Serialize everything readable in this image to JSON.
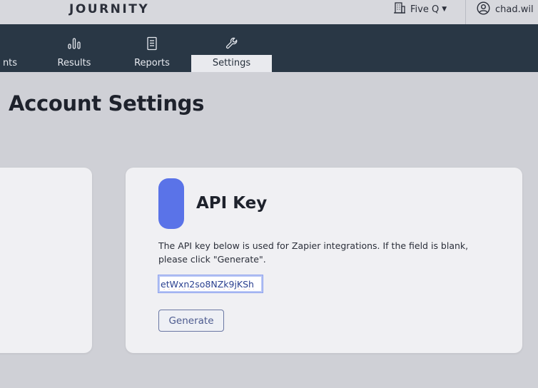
{
  "header": {
    "brand": "JOURNITY",
    "org_name": "Five Q",
    "user_name": "chad.wil"
  },
  "nav": {
    "tabs": [
      {
        "label": "nts",
        "icon": "partial-tab"
      },
      {
        "label": "Results",
        "icon": "bar-chart-icon"
      },
      {
        "label": "Reports",
        "icon": "document-icon"
      },
      {
        "label": "Settings",
        "icon": "wrench-icon",
        "active": true
      }
    ]
  },
  "main": {
    "page_title": "Account Settings",
    "api_card": {
      "title": "API Key",
      "description": "The API key below is used for Zapier integrations. If the field is blank, please click \"Generate\".",
      "key_value": "etWxn2so8NZk9jKSh",
      "generate_label": "Generate"
    }
  },
  "colors": {
    "nav_bg": "#293745",
    "accent": "#5a73e8",
    "page_bg": "#cfd0d6"
  }
}
